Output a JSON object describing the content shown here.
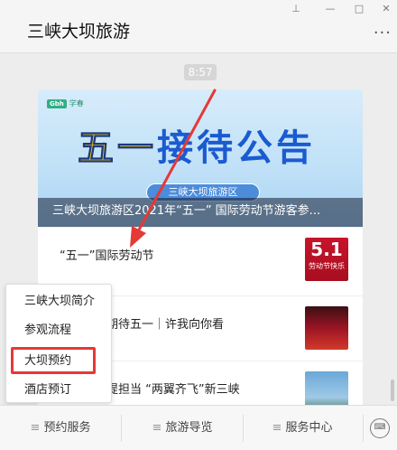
{
  "window": {
    "title": "三峡大坝旅游",
    "controls": [
      "pin-icon",
      "minimize-icon",
      "maximize-icon",
      "close-icon"
    ],
    "more": "···"
  },
  "chat": {
    "timestamp": "8:57",
    "card": {
      "banner": {
        "logo_label": "学春",
        "logo_badge": "Gbh",
        "headline_part1": "五一",
        "headline_part2": "接待公告",
        "sub": "三峡大坝旅游区",
        "overlay_title": "三峡大坝旅游区2021年“五一” 国际劳动节游客参..."
      },
      "articles": [
        {
          "text": "“五一”国际劳动节",
          "thumb_big": "5.1",
          "thumb_small": "劳动节快乐"
        },
        {
          "text": "期待五一｜许我向你看"
        },
        {
          "text": "提担当 “两翼齐飞”新三峡"
        }
      ]
    }
  },
  "popup_menu": {
    "items": [
      "三峡大坝简介",
      "参观流程",
      "大坝预约",
      "酒店预订"
    ],
    "highlighted_index": 2
  },
  "bottom_menu": {
    "tabs": [
      {
        "prefix": "≡",
        "label": "预约服务"
      },
      {
        "prefix": "≡",
        "label": "旅游导览"
      },
      {
        "prefix": "≡",
        "label": "服务中心"
      }
    ],
    "keyboard_icon": "⌨"
  },
  "colors": {
    "highlight": "#e53935",
    "arrow": "#e53935"
  }
}
